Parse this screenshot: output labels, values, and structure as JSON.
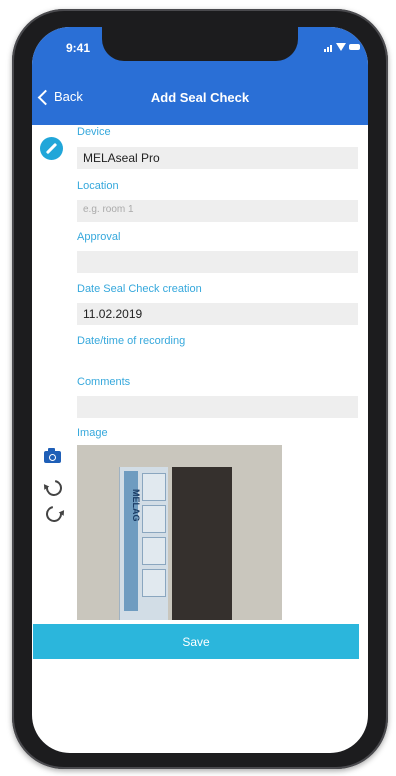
{
  "status_bar": {
    "time": "9:41"
  },
  "nav": {
    "back_label": "Back",
    "title": "Add Seal Check"
  },
  "form": {
    "device": {
      "label": "Device",
      "value": "MELAseal Pro"
    },
    "location": {
      "label": "Location",
      "placeholder": "e.g. room 1"
    },
    "approval": {
      "label": "Approval",
      "value": ""
    },
    "date_creation": {
      "label": "Date Seal Check creation",
      "value": "11.02.2019"
    },
    "date_recording": {
      "label": "Date/time of recording",
      "value": ""
    },
    "comments": {
      "label": "Comments",
      "value": ""
    },
    "image": {
      "label": "Image",
      "seal_text": "MELAG"
    }
  },
  "save_label": "Save",
  "icons": {
    "edit": "edit-icon",
    "camera": "camera-icon",
    "rotate_left": "rotate-left-icon",
    "rotate_right": "rotate-right-icon",
    "back": "chevron-left-icon"
  },
  "colors": {
    "nav_background": "#2a6fd6",
    "label_text": "#36a8dc",
    "save_button": "#2bb6dc",
    "field_background": "#eeeeee"
  }
}
